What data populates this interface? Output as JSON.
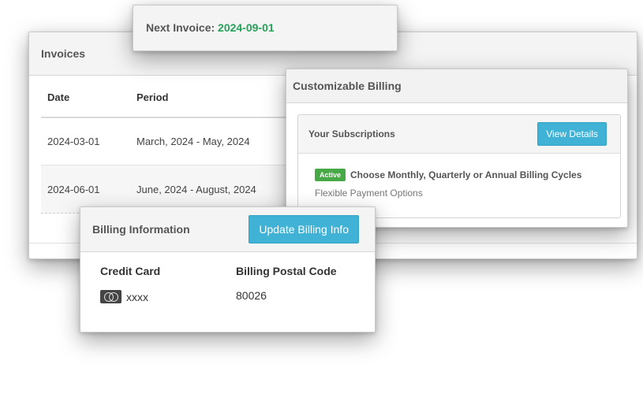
{
  "invoices": {
    "title": "Invoices",
    "columns": {
      "date": "Date",
      "period": "Period"
    },
    "rows": [
      {
        "date": "2024-03-01",
        "period": "March, 2024 - May, 2024"
      },
      {
        "date": "2024-06-01",
        "period": "June, 2024 - August, 2024"
      }
    ]
  },
  "next_invoice": {
    "label": "Next Invoice:",
    "date": "2024-09-01",
    "date_color": "#27a05a"
  },
  "custom_billing": {
    "title": "Customizable Billing",
    "subscriptions": {
      "title": "Your Subscriptions",
      "button": "View Details",
      "status": "Active",
      "plan": "Choose Monthly, Quarterly or Annual Billing Cycles",
      "description": "Flexible Payment Options"
    }
  },
  "billing_info": {
    "title": "Billing Information",
    "button": "Update Billing Info",
    "credit_card_label": "Credit Card",
    "credit_card_icon": "mastercard-icon",
    "credit_card_value": "xxxx",
    "postal_code_label": "Billing Postal Code",
    "postal_code_value": "80026"
  },
  "colors": {
    "accent_button": "#3fb2d6",
    "active_badge": "#46a946"
  }
}
